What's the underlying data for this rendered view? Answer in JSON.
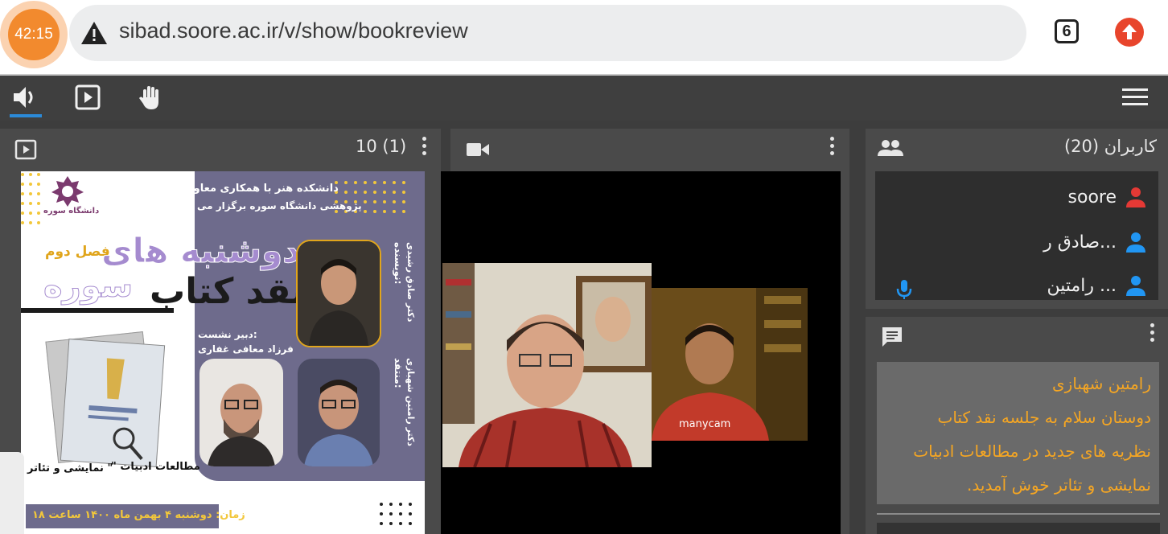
{
  "browser": {
    "timer": "42:15",
    "url": "sibad.soore.ac.ir/v/show/bookreview",
    "tab_count": "6",
    "colors": {
      "timer": "#f28a2e",
      "update": "#e8452c"
    }
  },
  "toolbar": {
    "icons": [
      "speaker-icon",
      "presentation-icon",
      "raise-hand-icon",
      "menu-icon"
    ],
    "active_color": "#2b8ad8"
  },
  "presentation": {
    "page_indicator": "10 (1)",
    "poster": {
      "org_line1": "دانشکده هنر با همکاری معاونت",
      "org_line2": "پژوهشی دانشگاه سوره برگزار می کند",
      "uni_label": "دانشگاه سوره",
      "season": "فصل دوم",
      "title_1": "دوشنبه های",
      "title_2": "سوره",
      "title_3": "نقد کتاب",
      "author_label": "نویسنده:",
      "author": "دکتر صادق رشیدی",
      "critic_label": "منتقد:",
      "critic": "دکتر رامتین شهبازی",
      "secretary_label": "دبیر نشست:",
      "secretary": "فرزاد معافی غفاری",
      "book_title_a": "\" مطالعات ادبیات",
      "book_title_b": "نمایشی و تئاتر \"",
      "time": "زمان: دوشنبه ۴ بهمن ماه ۱۴۰۰ ساعت ۱۸"
    }
  },
  "video": {
    "watermark": "manycam"
  },
  "users": {
    "title": "کاربران (20)",
    "items": [
      {
        "name": "soore",
        "color": "#e53935"
      },
      {
        "name": "صادق ر...",
        "color": "#2196f3"
      },
      {
        "name": "رامتین ...",
        "color": "#2196f3"
      }
    ]
  },
  "chat": {
    "sender": "رامتین شهبازی",
    "message_lines": [
      "دوستان سلام به جلسه نقد کتاب",
      "نظریه های جدید در مطالعات ادبیات",
      "نمایشی و تئاتر خوش آمدید."
    ],
    "text_color": "#f5a623"
  }
}
